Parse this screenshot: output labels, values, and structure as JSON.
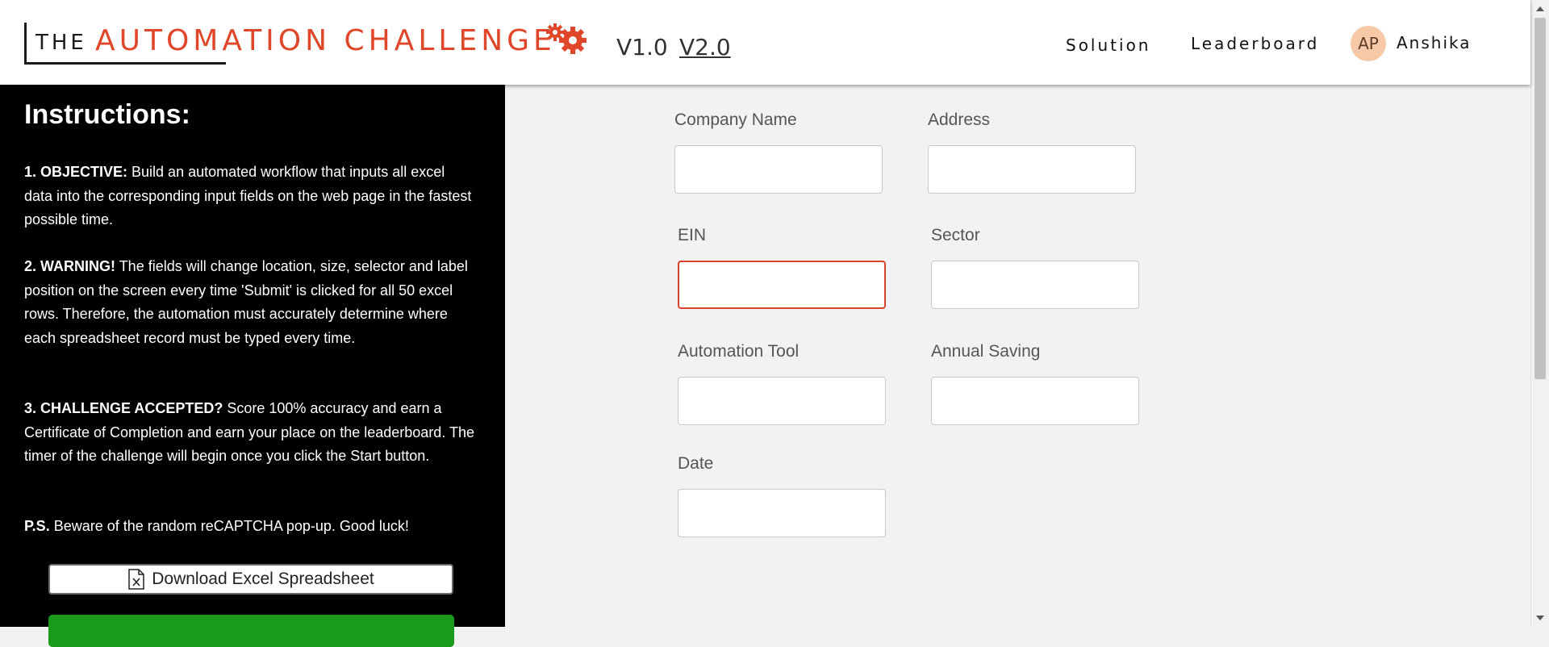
{
  "header": {
    "logo_the": "THE",
    "logo_main": "AUTOMATION CHALLENGE",
    "version_1": "V1.0",
    "version_2": "V2.0",
    "nav": {
      "solution": "Solution",
      "leaderboard": "Leaderboard"
    },
    "user": {
      "initials": "AP",
      "name": "Anshika"
    },
    "accent_color": "#e0472a"
  },
  "sidebar": {
    "title": "Instructions:",
    "items": [
      {
        "bold": "1. OBJECTIVE:",
        "text": " Build an automated workflow that inputs all excel data into the corresponding input fields on the web page in the fastest possible time."
      },
      {
        "bold": "2. WARNING!",
        "text": " The fields will change location, size, selector and label position on the screen every time 'Submit' is clicked for all 50 excel rows. Therefore, the automation must accurately determine where each spreadsheet record must be typed every time."
      },
      {
        "bold": "3. CHALLENGE ACCEPTED?",
        "text": " Score 100% accuracy and earn a Certificate of Completion and earn your place on the leaderboard. The timer of the challenge will begin once you click the Start button."
      },
      {
        "bold": "P.S.",
        "text": " Beware of the random reCAPTCHA pop-up. Good luck!"
      }
    ],
    "download_button": "Download Excel Spreadsheet",
    "start_button_color": "#1a9a1a"
  },
  "form": {
    "fields": [
      {
        "label": "Company Name",
        "value": ""
      },
      {
        "label": "Address",
        "value": ""
      },
      {
        "label": "EIN",
        "value": "",
        "focused": true
      },
      {
        "label": "Sector",
        "value": ""
      },
      {
        "label": "Automation Tool",
        "value": ""
      },
      {
        "label": "Annual Saving",
        "value": ""
      },
      {
        "label": "Date",
        "value": ""
      }
    ]
  }
}
